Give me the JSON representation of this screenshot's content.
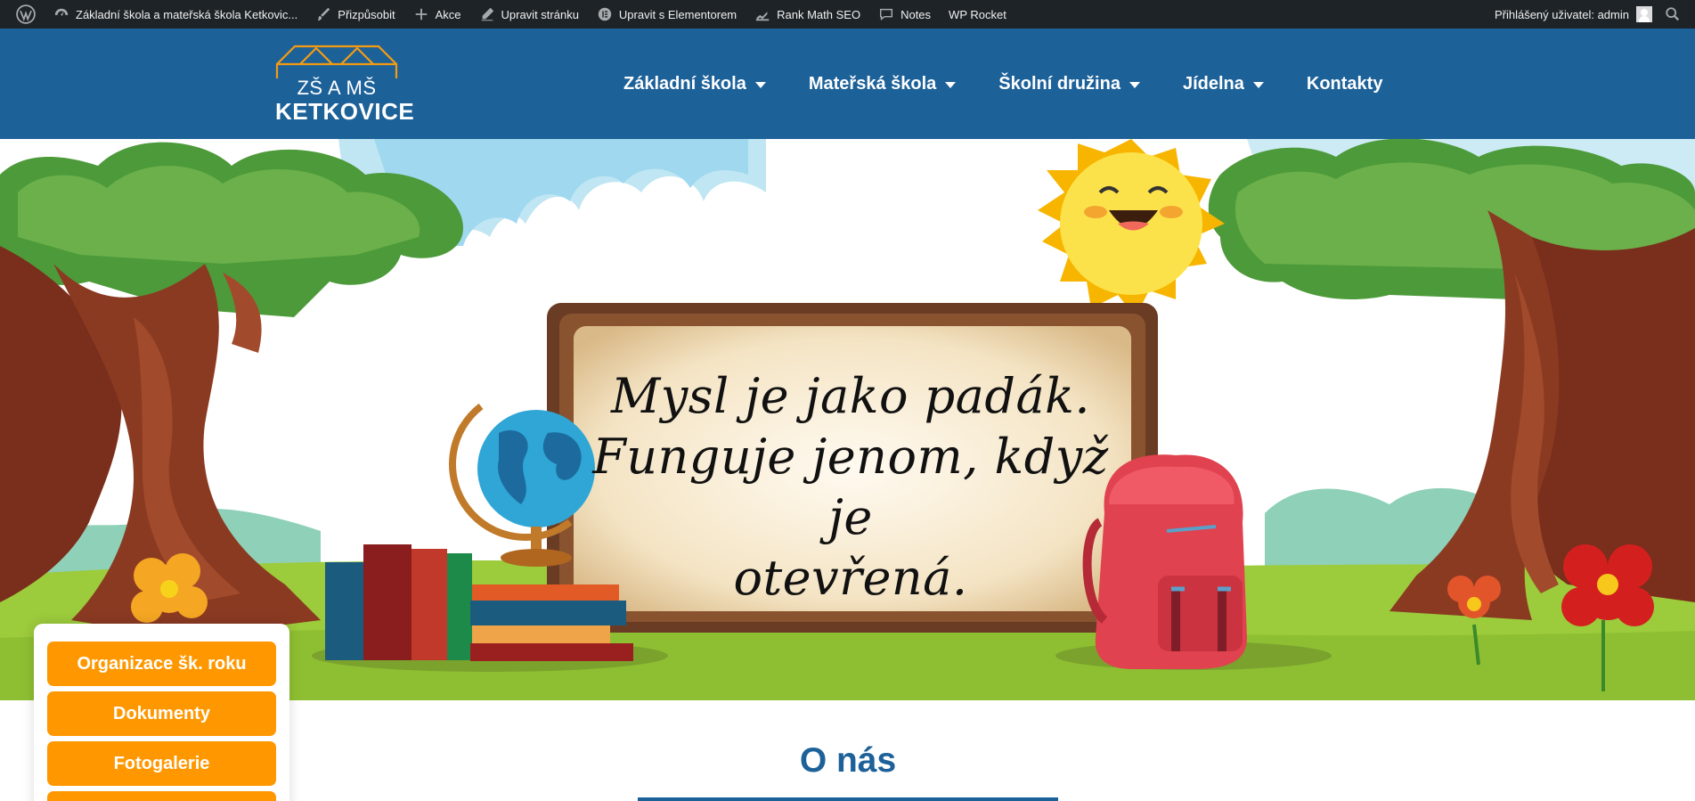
{
  "admin_bar": {
    "items": [
      {
        "icon": "wordpress-logo-icon",
        "label": ""
      },
      {
        "icon": "dashboard-icon",
        "label": "Základní škola a mateřská škola Ketkovic..."
      },
      {
        "icon": "brush-icon",
        "label": "Přizpůsobit"
      },
      {
        "icon": "plus-icon",
        "label": "Akce"
      },
      {
        "icon": "pencil-icon",
        "label": "Upravit stránku"
      },
      {
        "icon": "elementor-icon",
        "label": "Upravit s Elementorem"
      },
      {
        "icon": "rank-math-icon",
        "label": "Rank Math SEO"
      },
      {
        "icon": "notes-icon",
        "label": "Notes"
      },
      {
        "icon": "",
        "label": "WP Rocket"
      }
    ],
    "user_label": "Přihlášený uživatel: admin",
    "colors": {
      "background": "#1d2327",
      "text": "#f0f0f1"
    }
  },
  "header": {
    "logo_line1": "ZŠ A MŠ",
    "logo_line2": "KETKOVICE",
    "nav": [
      {
        "label": "Základní škola",
        "has_dropdown": true
      },
      {
        "label": "Mateřská škola",
        "has_dropdown": true
      },
      {
        "label": "Školní družina",
        "has_dropdown": true
      },
      {
        "label": "Jídelna",
        "has_dropdown": true
      },
      {
        "label": "Kontakty",
        "has_dropdown": false
      }
    ],
    "colors": {
      "background": "#1d6199",
      "logo_roof": "#f39c12"
    }
  },
  "hero": {
    "quote_line1": "Mysl je jako padák.",
    "quote_line2": "Funguje jenom, když je",
    "quote_line3": "otevřená."
  },
  "side_menu": {
    "buttons": [
      "Organizace šk. roku",
      "Dokumenty",
      "Fotogalerie"
    ],
    "button_color": "#ff9800"
  },
  "section": {
    "title": "O nás",
    "color": "#1d6199"
  }
}
